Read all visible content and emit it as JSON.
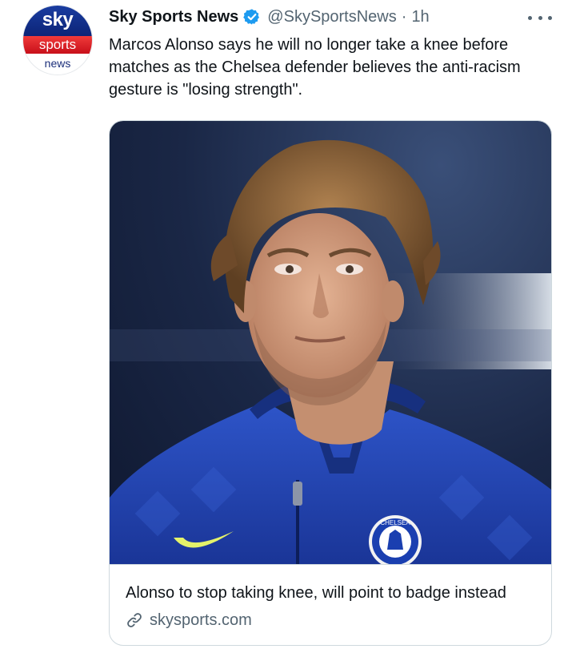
{
  "author": {
    "display_name": "Sky Sports News",
    "handle": "@SkySportsNews",
    "separator": "·",
    "time": "1h",
    "verified": true,
    "avatar": {
      "line1": "sky",
      "line2": "sports",
      "line3": "news"
    }
  },
  "tweet": {
    "text": "Marcos Alonso says he will no longer take a knee before matches as the Chelsea defender believes the anti-racism gesture is \"losing strength\"."
  },
  "card": {
    "title": "Alonso to stop taking knee, will point to badge instead",
    "domain": "skysports.com",
    "image_alt": "Marcos Alonso in a Chelsea shirt",
    "badge_text": "CHELSEA"
  },
  "icons": {
    "verified": "verified-badge-icon",
    "more": "more-options-icon",
    "link": "link-icon"
  },
  "colors": {
    "verified": "#1d9bf0",
    "secondary_text": "#536471",
    "primary_text": "#0f1419",
    "border": "#cfd9de",
    "sky_blue": "#0c2477",
    "sky_red": "#d0101a",
    "chelsea_blue": "#1a3fb0"
  }
}
